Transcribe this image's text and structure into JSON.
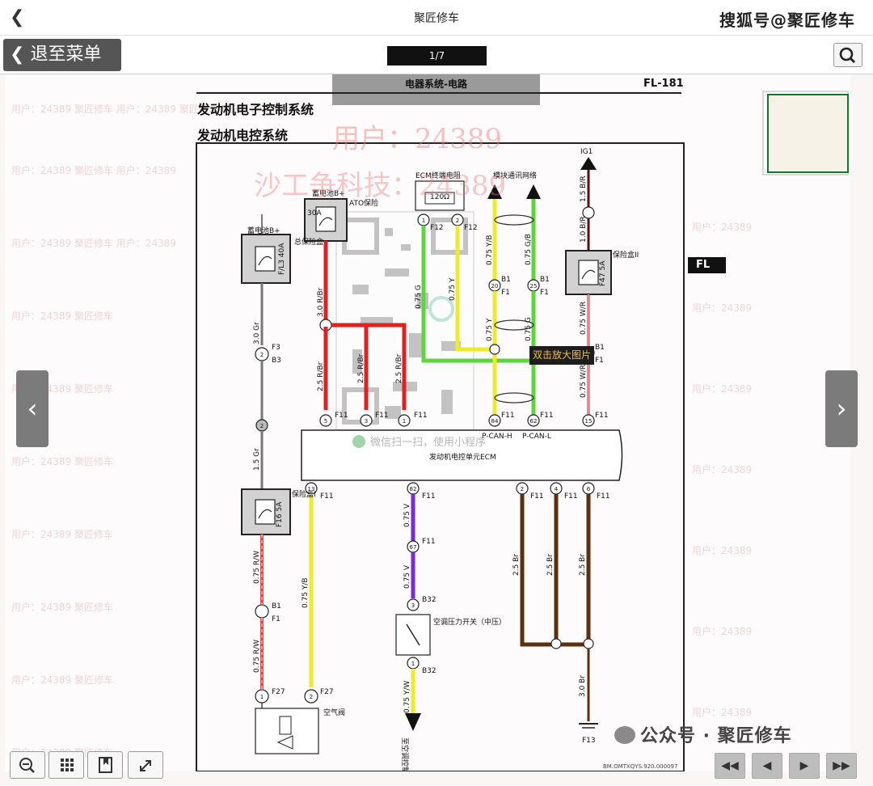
{
  "app": {
    "title": "聚匠修车",
    "watermark": "搜狐号@聚匠修车"
  },
  "toolbar": {
    "back_to_menu": "退至菜单",
    "page_indicator": "1/7"
  },
  "document": {
    "header": "电器系统-电路",
    "code": "FL-181",
    "title1": "发动机电子控制系统",
    "title2": "发动机电控系统",
    "tag": "FL",
    "watermark_line1": "用户：24389",
    "watermark_line2": "沙工争科技：24389",
    "zoom_hint": "双击放大图片",
    "wechat_hint": "微信扫一扫，使用小程序",
    "doc_number": "BM.OMTXQYS.920.000097"
  },
  "diagram": {
    "labels": {
      "battery_b1": "蓄电池B+",
      "battery_b2": "蓄电池B+",
      "main_fuse_box": "总保险盒",
      "fuse_fl3": "F/L3 40A",
      "fuse_30a": "30A",
      "ato_fuse": "ATO保险",
      "ecm_resistor": "ECM终端电阻",
      "ohm": "120Ω",
      "can_net": "模块通讯网络",
      "ig1": "IG1",
      "fuse_box2": "保险盒II",
      "fuse_f47": "F47 5A",
      "fuse_box1": "保险盒I",
      "fuse_f16": "F16 5A",
      "ecm": "发动机电控单元ECM",
      "pcan_h": "P-CAN-H",
      "pcan_l": "P-CAN-L",
      "ac_switch": "空调压力开关（中压）",
      "ac_valve": "空气阀",
      "to_ac": "至空调控制器",
      "ground": "F13"
    },
    "wires": [
      "3.0 Gr",
      "3.0 R/Br",
      "2.5 R/Br",
      "2.5 R/Br",
      "2.5 R/Br",
      "0.75 G",
      "0.75 Y",
      "0.75 Y/B",
      "0.75 G/B",
      "0.75 Y",
      "0.75 G",
      "1.5 B/R",
      "1.0 B/R",
      "0.75 W/R",
      "0.75 W/R",
      "1.5 Gr",
      "0.75 R/W",
      "0.75 R/W",
      "0.75 Y/B",
      "0.75 V",
      "0.75 V",
      "0.75 Y/W",
      "2.5 Br",
      "2.5 Br",
      "2.5 Br",
      "3.0 Br"
    ],
    "connectors": [
      "F3",
      "B3",
      "F12",
      "F12",
      "B1",
      "F1",
      "B1",
      "F1",
      "B1",
      "F1",
      "F11",
      "F11",
      "F11",
      "F11",
      "F11",
      "F11",
      "F11",
      "F11",
      "F11",
      "F11",
      "F11",
      "F11",
      "B1",
      "F1",
      "F27",
      "F27",
      "B32",
      "B32"
    ],
    "pins": [
      "2",
      "2",
      "1",
      "2",
      "20",
      "25",
      "18",
      "5",
      "3",
      "1",
      "84",
      "62",
      "15",
      "13",
      "82",
      "2",
      "4",
      "6",
      "67",
      "3",
      "1",
      "1",
      "2"
    ]
  },
  "bottombar": {
    "publisher": "公众号 · 聚匠修车",
    "nav_first": "◀◀",
    "nav_prev": "◀",
    "nav_next": "▶",
    "nav_last": "▶▶"
  },
  "side": {
    "prev": "‹",
    "next": "›"
  }
}
